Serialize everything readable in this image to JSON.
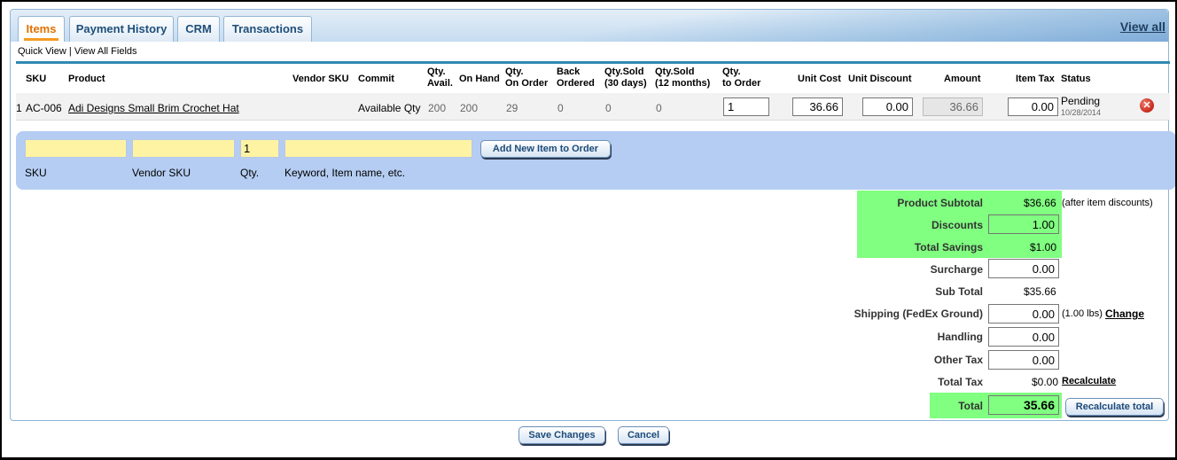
{
  "tabs": [
    {
      "label": "Items",
      "active": true
    },
    {
      "label": "Payment History",
      "active": false
    },
    {
      "label": "CRM",
      "active": false
    },
    {
      "label": "Transactions",
      "active": false
    }
  ],
  "view_all": "View all",
  "subnav": {
    "quick_view": "Quick View",
    "separator": "|",
    "view_all_fields": "View All Fields"
  },
  "columns": {
    "sku": "SKU",
    "product": "Product",
    "vendor_sku": "Vendor SKU",
    "commit": "Commit",
    "qty_avail": [
      "Qty.",
      "Avail."
    ],
    "on_hand": "On Hand",
    "qty_on_order": [
      "Qty.",
      "On Order"
    ],
    "back_ordered": [
      "Back",
      "Ordered"
    ],
    "qty_sold_30": [
      "Qty.Sold",
      "(30 days)"
    ],
    "qty_sold_12": [
      "Qty.Sold",
      "(12 months)"
    ],
    "qty_to_order": [
      "Qty.",
      "to Order"
    ],
    "unit_cost": "Unit Cost",
    "unit_discount": "Unit Discount",
    "amount": "Amount",
    "item_tax": "Item Tax",
    "status": "Status"
  },
  "items": [
    {
      "index": "1",
      "sku": "AC-006",
      "product": "Adi Designs Small Brim Crochet Hat",
      "commit": "Available Qty",
      "qty_avail": "200",
      "on_hand": "200",
      "qty_on_order": "29",
      "back_ordered": "0",
      "qty_sold_30": "0",
      "qty_sold_12": "0",
      "qty_to_order": "1",
      "unit_cost": "36.66",
      "unit_discount": "0.00",
      "amount": "36.66",
      "item_tax": "0.00",
      "status": "Pending",
      "status_date": "10/28/2014",
      "remove_icon": "remove-x-icon"
    }
  ],
  "add_item": {
    "sku_value": "",
    "vendor_sku_value": "",
    "qty_value": "1",
    "keyword_value": "",
    "button": "Add New Item to Order",
    "labels": {
      "sku": "SKU",
      "vendor_sku": "Vendor SKU",
      "qty": "Qty.",
      "keyword": "Keyword, Item name, etc."
    }
  },
  "totals": {
    "product_subtotal": {
      "label": "Product Subtotal",
      "value": "$36.66",
      "note": "(after item discounts)"
    },
    "discounts": {
      "label": "Discounts",
      "value": "1.00"
    },
    "total_savings": {
      "label": "Total Savings",
      "value": "$1.00"
    },
    "surcharge": {
      "label": "Surcharge",
      "value": "0.00"
    },
    "sub_total": {
      "label": "Sub Total",
      "value": "$35.66"
    },
    "shipping": {
      "label": "Shipping (FedEx Ground)",
      "value": "0.00",
      "note": "(1.00 lbs)",
      "link": "Change"
    },
    "handling": {
      "label": "Handling",
      "value": "0.00"
    },
    "other_tax": {
      "label": "Other Tax",
      "value": "0.00"
    },
    "total_tax": {
      "label": "Total Tax",
      "value": "$0.00",
      "link": "Recalculate"
    },
    "total": {
      "label": "Total",
      "value": "35.66",
      "button": "Recalculate total"
    }
  },
  "actions": {
    "save": "Save Changes",
    "cancel": "Cancel"
  },
  "colors": {
    "highlight_green": "#80ff80",
    "tab_active_text": "#e27100",
    "add_box_bg": "#b5cdf2",
    "input_yellow": "#fdf3a3"
  }
}
